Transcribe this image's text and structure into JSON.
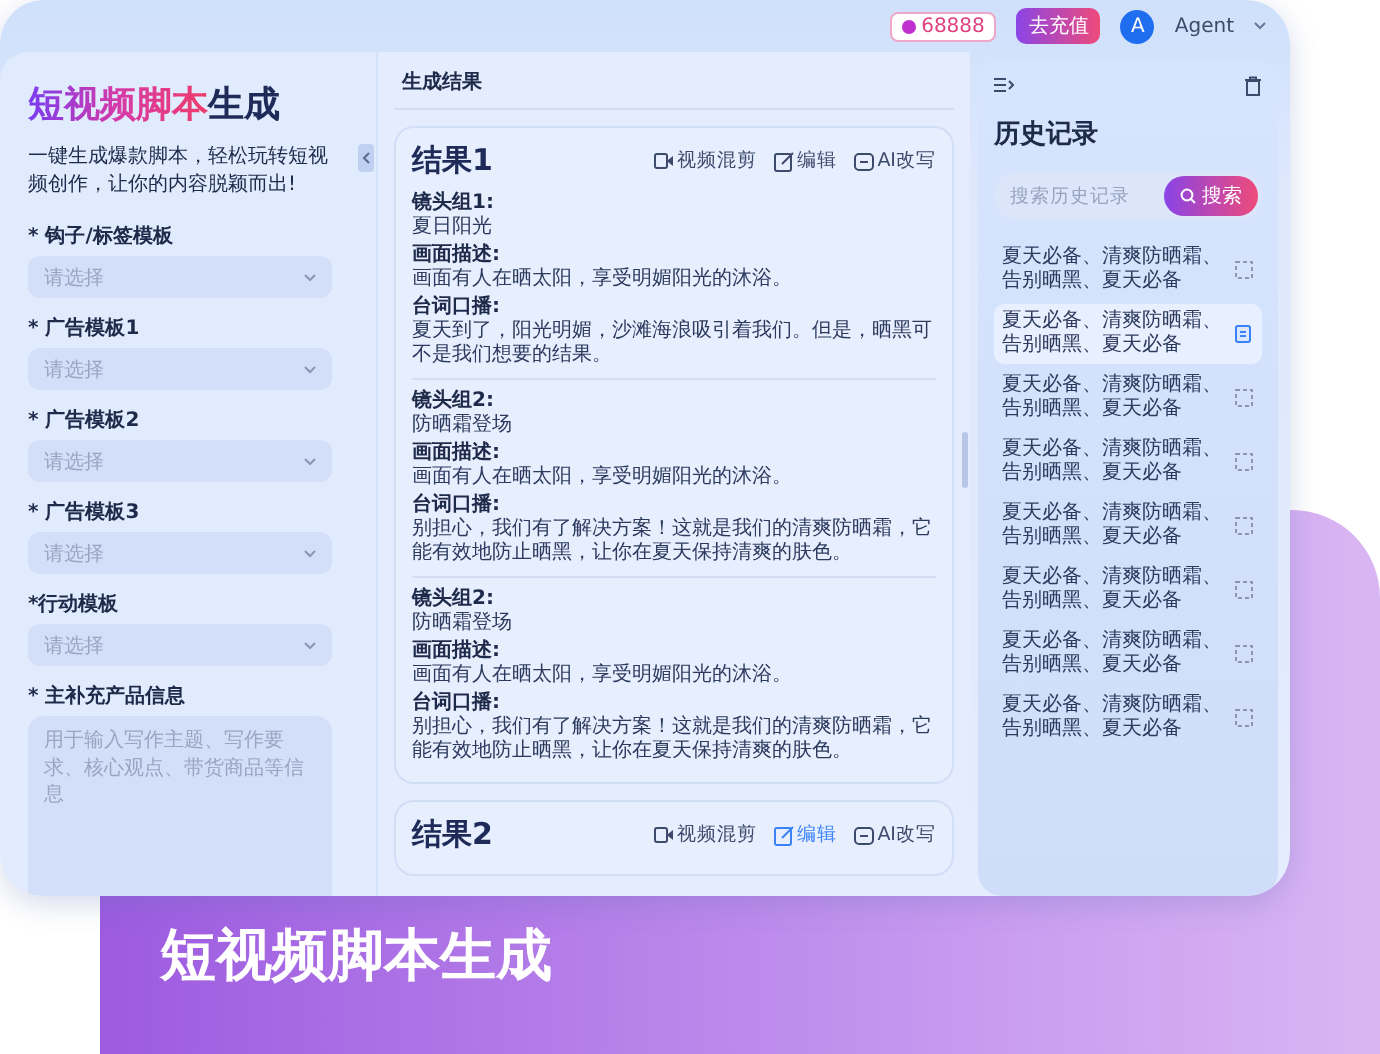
{
  "topbar": {
    "points": "68888",
    "action_button": "去充值",
    "user": {
      "initial": "A",
      "name": "Agent"
    }
  },
  "form": {
    "title": [
      {
        "text": "短视频脚本",
        "kind": "gradient"
      },
      {
        "text": "生成",
        "kind": "plain"
      }
    ],
    "description": "一键生成爆款脚本，轻松玩转短视频创作，让你的内容脱颖而出!",
    "fields": [
      {
        "kind": "select",
        "label": "* 钩子/标签模板",
        "placeholder": "请选择"
      },
      {
        "kind": "select",
        "label": "* 广告模板1",
        "placeholder": "请选择"
      },
      {
        "kind": "select",
        "label": "* 广告模板2",
        "placeholder": "请选择"
      },
      {
        "kind": "select",
        "label": "* 广告模板3",
        "placeholder": "请选择"
      },
      {
        "kind": "select",
        "label": "*行动模板",
        "placeholder": "请选择"
      },
      {
        "kind": "textarea",
        "label": "* 主补充产品信息",
        "placeholder": "用于输入写作主题、写作要求、核心观点、带货商品等信息"
      }
    ]
  },
  "results": {
    "heading": "生成结果",
    "cards": [
      {
        "title": "结果1",
        "actions": [
          {
            "label": "视频混剪",
            "kind": "video",
            "selected": false
          },
          {
            "label": "编辑",
            "kind": "edit",
            "selected": false
          },
          {
            "label": "AI改写",
            "kind": "rewrite",
            "selected": false
          }
        ],
        "shots": [
          [
            {
              "label": "镜头组1:",
              "value": "夏日阳光"
            },
            {
              "label": "画面描述:",
              "value": "画面有人在晒太阳，享受明媚阳光的沐浴。"
            },
            {
              "label": "台词口播:",
              "value": "夏天到了，阳光明媚，沙滩海浪吸引着我们。但是，晒黑可不是我们想要的结果。"
            }
          ],
          [
            {
              "label": "镜头组2:",
              "value": "防晒霜登场"
            },
            {
              "label": "画面描述:",
              "value": "画面有人在晒太阳，享受明媚阳光的沐浴。"
            },
            {
              "label": "台词口播:",
              "value": "别担心，我们有了解决方案！这就是我们的清爽防晒霜，它能有效地防止晒黑，让你在夏天保持清爽的肤色。"
            }
          ],
          [
            {
              "label": "镜头组2:",
              "value": "防晒霜登场"
            },
            {
              "label": "画面描述:",
              "value": "画面有人在晒太阳，享受明媚阳光的沐浴。"
            },
            {
              "label": "台词口播:",
              "value": "别担心，我们有了解决方案！这就是我们的清爽防晒霜，它能有效地防止晒黑，让你在夏天保持清爽的肤色。"
            }
          ]
        ]
      },
      {
        "title": "结果2",
        "actions": [
          {
            "label": "视频混剪",
            "kind": "video",
            "selected": false
          },
          {
            "label": "编辑",
            "kind": "edit",
            "selected": true
          },
          {
            "label": "AI改写",
            "kind": "rewrite",
            "selected": false
          }
        ]
      }
    ]
  },
  "history": {
    "title": "历史记录",
    "search": {
      "placeholder": "搜索历史记录",
      "button": "搜索"
    },
    "items": [
      {
        "text": "夏天必备、清爽防晒霜、告别晒黑、夏天必备",
        "selected": false
      },
      {
        "text": "夏天必备、清爽防晒霜、告别晒黑、夏天必备",
        "selected": true
      },
      {
        "text": "夏天必备、清爽防晒霜、告别晒黑、夏天必备",
        "selected": false
      },
      {
        "text": "夏天必备、清爽防晒霜、告别晒黑、夏天必备",
        "selected": false
      },
      {
        "text": "夏天必备、清爽防晒霜、告别晒黑、夏天必备",
        "selected": false
      },
      {
        "text": "夏天必备、清爽防晒霜、告别晒黑、夏天必备",
        "selected": false
      },
      {
        "text": "夏天必备、清爽防晒霜、告别晒黑、夏天必备",
        "selected": false
      },
      {
        "text": "夏天必备、清爽防晒霜、告别晒黑、夏天必备",
        "selected": false
      }
    ]
  },
  "banner": {
    "title": "短视频脚本生成"
  }
}
